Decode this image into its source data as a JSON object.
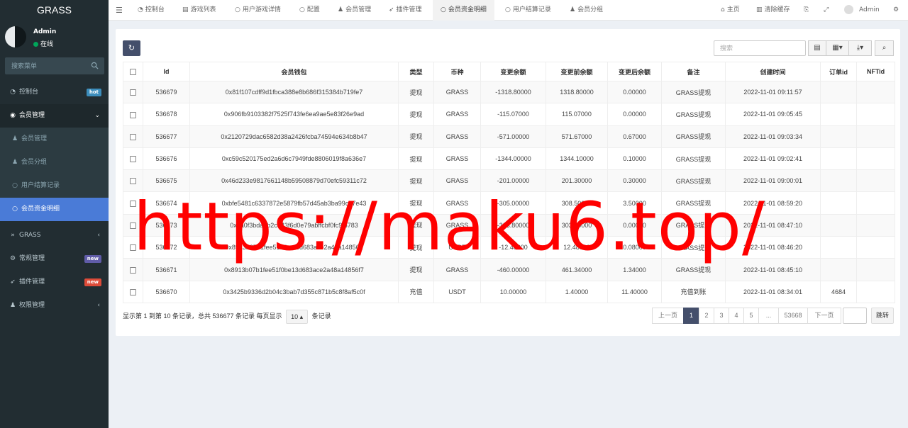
{
  "app": {
    "logo": "GRASS"
  },
  "user": {
    "name": "Admin",
    "status": "在线"
  },
  "sidebar": {
    "search_placeholder": "搜索菜单",
    "items": [
      {
        "label": "控制台",
        "icon": "dashboard-icon",
        "badge": "hot",
        "badge_color": "#3c8dbc"
      },
      {
        "label": "会员管理",
        "icon": "user-circle-icon",
        "expanded": true
      },
      {
        "label": "GRASS",
        "icon": "double-chevron-icon"
      },
      {
        "label": "常规管理",
        "icon": "cogs-icon",
        "badge": "new",
        "badge_color": "#605ca8"
      },
      {
        "label": "插件管理",
        "icon": "rocket-icon",
        "badge": "new",
        "badge_color": "#dd4b39"
      },
      {
        "label": "权限管理",
        "icon": "group-icon"
      }
    ],
    "submenu": [
      {
        "label": "会员管理",
        "icon": "user-icon"
      },
      {
        "label": "会员分组",
        "icon": "users-icon"
      },
      {
        "label": "用户结算记录",
        "icon": "circle-icon"
      },
      {
        "label": "会员资金明细",
        "icon": "circle-icon",
        "selected": true
      }
    ]
  },
  "topnav": {
    "tabs": [
      {
        "label": "控制台",
        "icon": "dashboard-icon"
      },
      {
        "label": "游戏列表",
        "icon": "list-icon"
      },
      {
        "label": "用户游戏详情",
        "icon": "circle-icon"
      },
      {
        "label": "配置",
        "icon": "circle-icon"
      },
      {
        "label": "会员管理",
        "icon": "user-icon"
      },
      {
        "label": "插件管理",
        "icon": "rocket-icon"
      },
      {
        "label": "会员资金明细",
        "icon": "circle-icon",
        "selected": true
      },
      {
        "label": "用户结算记录",
        "icon": "circle-icon"
      },
      {
        "label": "会员分组",
        "icon": "users-icon"
      }
    ],
    "right": {
      "home": "主页",
      "clear_cache": "清除缓存",
      "user": "Admin"
    }
  },
  "toolbar": {
    "search_placeholder": "搜索"
  },
  "table": {
    "columns": [
      "Id",
      "会员钱包",
      "类型",
      "币种",
      "变更余额",
      "变更前余额",
      "变更后余额",
      "备注",
      "创建时间",
      "订单id",
      "NFTid"
    ],
    "rows": [
      [
        "536679",
        "0x81f107cdff9d1fbca388e8b686f315384b719fe7",
        "提现",
        "GRASS",
        "-1318.80000",
        "1318.80000",
        "0.00000",
        "GRASS提现",
        "2022-11-01 09:11:57",
        "",
        ""
      ],
      [
        "536678",
        "0x906fb9103382f7525f743fe6ea9ae5e83f26e9ad",
        "提现",
        "GRASS",
        "-115.07000",
        "115.07000",
        "0.00000",
        "GRASS提现",
        "2022-11-01 09:05:45",
        "",
        ""
      ],
      [
        "536677",
        "0x2120729dac6582d38a2426fcba74594e634b8b47",
        "提现",
        "GRASS",
        "-571.00000",
        "571.67000",
        "0.67000",
        "GRASS提现",
        "2022-11-01 09:03:34",
        "",
        ""
      ],
      [
        "536676",
        "0xc59c520175ed2a6d6c7949fde8806019f8a636e7",
        "提现",
        "GRASS",
        "-1344.00000",
        "1344.10000",
        "0.10000",
        "GRASS提现",
        "2022-11-01 09:02:41",
        "",
        ""
      ],
      [
        "536675",
        "0x46d233e9817661148b59508879d70efc59311c72",
        "提现",
        "GRASS",
        "-201.00000",
        "201.30000",
        "0.30000",
        "GRASS提现",
        "2022-11-01 09:00:01",
        "",
        ""
      ],
      [
        "536674",
        "0xbfe5481c6337872e5879fb57d45ab3ba99c37e43",
        "提现",
        "GRASS",
        "-305.00000",
        "308.50000",
        "3.50000",
        "GRASS提现",
        "2022-11-01 08:59:20",
        "",
        ""
      ],
      [
        "536673",
        "0x4a0f3bda8b2c343f6d0e79abffcbf0fc9f8783",
        "提现",
        "GRASS",
        "-303.80000",
        "303.80000",
        "0.00000",
        "GRASS提现",
        "2022-11-01 08:47:10",
        "",
        ""
      ],
      [
        "536672",
        "0x8913b07b1fee51f0be13d683ace2a48a148561",
        "提现",
        "USDT",
        "-12.40000",
        "12.48000",
        "0.08000",
        "GRASS提现",
        "2022-11-01 08:46:20",
        "",
        ""
      ],
      [
        "536671",
        "0x8913b07b1fee51f0be13d683ace2a48a14856f7",
        "提现",
        "GRASS",
        "-460.00000",
        "461.34000",
        "1.34000",
        "GRASS提现",
        "2022-11-01 08:45:10",
        "",
        ""
      ],
      [
        "536670",
        "0x3425b9336d2b04c3bab7d355c871b5c8f8af5c0f",
        "充值",
        "USDT",
        "10.00000",
        "1.40000",
        "11.40000",
        "充值到账",
        "2022-11-01 08:34:01",
        "4684",
        ""
      ]
    ]
  },
  "pagination": {
    "info": "显示第 1 到第 10 条记录，总共 536677 条记录 每页显示",
    "page_size": "10",
    "suffix": "条记录",
    "prev": "上一页",
    "pages": [
      "1",
      "2",
      "3",
      "4",
      "5",
      "...",
      "53668"
    ],
    "next": "下一页",
    "jump": "跳转"
  },
  "watermark": "https://maku6.top/"
}
